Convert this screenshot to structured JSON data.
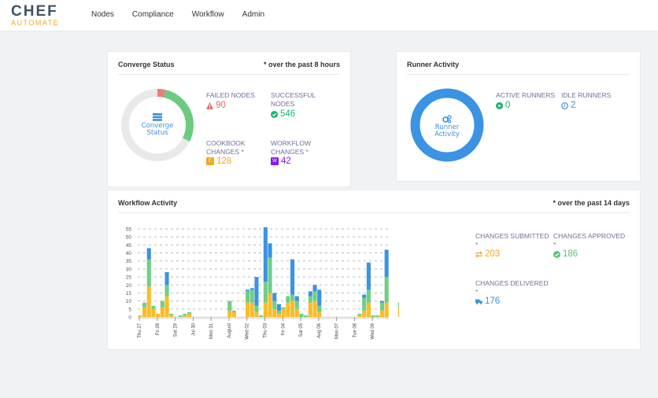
{
  "brand": {
    "name": "CHEF",
    "sub": "AUTOMATE"
  },
  "nav": [
    "Nodes",
    "Compliance",
    "Workflow",
    "Admin"
  ],
  "converge": {
    "title": "Converge Status",
    "note": "* over the past 8 hours",
    "center_label_1": "Converge",
    "center_label_2": "Status",
    "failed": {
      "label": "FAILED NODES",
      "value": "90",
      "color": "#e8686b"
    },
    "successful": {
      "label_1": "SUCCESSFUL",
      "label_2": "NODES",
      "value": "546",
      "color": "#1bb374"
    },
    "cookbook": {
      "label_1": "COOKBOOK",
      "label_2": "CHANGES *",
      "value": "128",
      "badge": "C",
      "color": "#f5a623"
    },
    "workflow": {
      "label_1": "WORKFLOW",
      "label_2": "CHANGES *",
      "value": "42",
      "badge": "W",
      "color": "#9013fe"
    },
    "donut": {
      "failed_fraction": 0.035,
      "success_fraction": 0.29,
      "colors": {
        "failed": "#f07b7b",
        "success": "#6bcb7f",
        "rest": "#e9e9e9"
      }
    }
  },
  "runner": {
    "title": "Runner Activity",
    "center_label_1": "Runner",
    "center_label_2": "Activity",
    "active": {
      "label": "ACTIVE RUNNERS",
      "value": "0",
      "color": "#1bb374"
    },
    "idle": {
      "label": "IDLE RUNNERS",
      "value": "2",
      "color": "#3c8fdd"
    },
    "ring_color": "#3b93e3"
  },
  "workflow_activity": {
    "title": "Workflow Activity",
    "note": "* over the past 14 days",
    "submitted": {
      "label": "CHANGES SUBMITTED",
      "star": "*",
      "value": "203",
      "color": "#f5a623"
    },
    "approved": {
      "label": "CHANGES APPROVED",
      "star": "*",
      "value": "186",
      "color": "#5bc27a"
    },
    "delivered": {
      "label": "CHANGES DELIVERED",
      "star": "*",
      "value": "176",
      "color": "#3b93e3"
    }
  },
  "chart_data": {
    "type": "bar",
    "stacked": true,
    "title": "",
    "xlabel": "",
    "ylabel": "",
    "ylim": [
      0,
      55
    ],
    "yticks": [
      0,
      5,
      10,
      15,
      20,
      25,
      30,
      35,
      40,
      45,
      50,
      55
    ],
    "grid": true,
    "day_labels": [
      "Thu 27",
      "Fri 28",
      "Sat 29",
      "Jul 30",
      "Mon 31",
      "August",
      "Wed 02",
      "Thu 03",
      "Fri 04",
      "Sat 05",
      "Aug 06",
      "Mon 07",
      "Tue 08",
      "Wed 09"
    ],
    "bars_per_day": 4,
    "series": [
      {
        "name": "Submitted",
        "color": "#fbbc27",
        "values": [
          1,
          6,
          19,
          5,
          2,
          6,
          13,
          1,
          0,
          0,
          1,
          2,
          0,
          0,
          0,
          0,
          0,
          0,
          0,
          0,
          4,
          3,
          0,
          0,
          9,
          9,
          3,
          0,
          9,
          15,
          5,
          2,
          5,
          9,
          10,
          5,
          0,
          0,
          9,
          10,
          3,
          0,
          0,
          0,
          0,
          0,
          0,
          0,
          0,
          1,
          4,
          9,
          0,
          0,
          4,
          9,
          0,
          0,
          6,
          7
        ]
      },
      {
        "name": "Approved",
        "color": "#6fce87",
        "values": [
          0,
          3,
          17,
          2,
          0,
          4,
          7,
          1,
          0,
          1,
          1,
          1,
          0,
          0,
          0,
          0,
          0,
          0,
          0,
          0,
          6,
          1,
          0,
          0,
          7,
          8,
          4,
          1,
          13,
          22,
          5,
          2,
          1,
          4,
          4,
          5,
          2,
          1,
          4,
          6,
          4,
          0,
          0,
          0,
          0,
          0,
          0,
          0,
          0,
          1,
          8,
          8,
          1,
          1,
          5,
          16,
          0,
          0,
          3,
          6
        ]
      },
      {
        "name": "Delivered",
        "color": "#3b93e3",
        "values": [
          0,
          0,
          7,
          0,
          0,
          0,
          8,
          0,
          0,
          0,
          0,
          0,
          0,
          0,
          0,
          0,
          0,
          0,
          0,
          0,
          0,
          0,
          0,
          0,
          1,
          1,
          18,
          0,
          34,
          9,
          5,
          4,
          0,
          0,
          22,
          3,
          0,
          0,
          3,
          4,
          10,
          0,
          0,
          0,
          0,
          0,
          0,
          0,
          0,
          0,
          2,
          17,
          0,
          0,
          1,
          17,
          0,
          0,
          0,
          8
        ]
      }
    ]
  }
}
